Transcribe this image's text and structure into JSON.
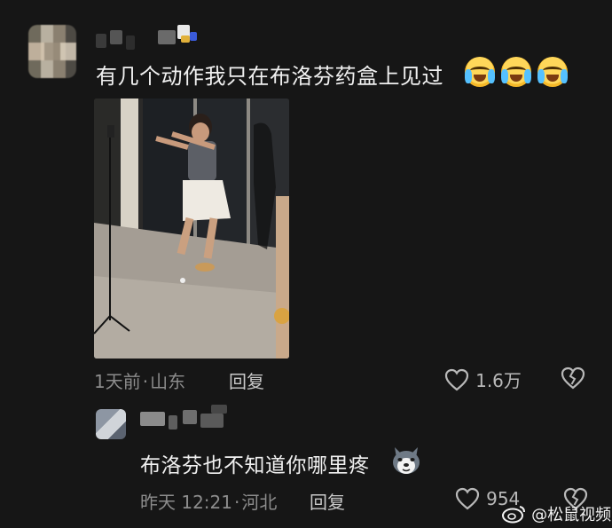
{
  "comment": {
    "text": "有几个动作我只在布洛芬药盒上见过",
    "emoji_count": 3,
    "emoji_icon": "crying-laughing-face-icon",
    "time": "1天前",
    "location_sep": "·",
    "location": "山东",
    "reply_label": "回复",
    "likes": "1.6万",
    "like_icon": "heart-outline-icon",
    "dislike_icon": "broken-heart-icon"
  },
  "reply_comment": {
    "text": "布洛芬也不知道你哪里疼",
    "emoji_icon": "husky-dog-face-icon",
    "time": "昨天 12:21",
    "location_sep": "·",
    "location": "河北",
    "reply_label": "回复",
    "likes": "954",
    "like_icon": "heart-outline-icon",
    "dislike_icon": "broken-heart-icon"
  },
  "watermark": {
    "text": "@松鼠视频",
    "icon": "weibo-logo-icon"
  },
  "colors": {
    "background": "#161616",
    "meta_text": "#8c8c8c",
    "body_text": "#f1f1f1"
  }
}
